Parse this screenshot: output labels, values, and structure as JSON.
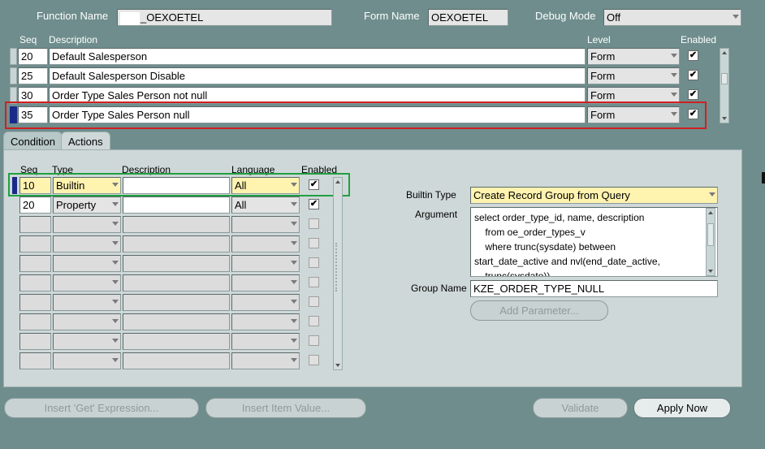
{
  "header": {
    "function_name_label": "Function Name",
    "function_name_value": "_OEXOETEL",
    "form_name_label": "Form Name",
    "form_name_value": "OEXOETEL",
    "debug_mode_label": "Debug Mode",
    "debug_mode_value": "Off"
  },
  "rules": {
    "col_seq": "Seq",
    "col_description": "Description",
    "col_level": "Level",
    "col_enabled": "Enabled",
    "rows": [
      {
        "seq": "20",
        "description": "Default Salesperson",
        "level": "Form",
        "enabled": "✔"
      },
      {
        "seq": "25",
        "description": "Default Salesperson Disable",
        "level": "Form",
        "enabled": "✔"
      },
      {
        "seq": "30",
        "description": "Order Type Sales Person not null",
        "level": "Form",
        "enabled": "✔"
      },
      {
        "seq": "35",
        "description": "Order Type Sales Person null",
        "level": "Form",
        "enabled": "✔"
      }
    ]
  },
  "tabs": {
    "condition": "Condition",
    "actions": "Actions"
  },
  "actions": {
    "col_seq": "Seq",
    "col_type": "Type",
    "col_description": "Description",
    "col_language": "Language",
    "col_enabled": "Enabled",
    "rows": [
      {
        "seq": "10",
        "type": "Builtin",
        "description": "",
        "language": "All",
        "enabled": "✔"
      },
      {
        "seq": "20",
        "type": "Property",
        "description": "",
        "language": "All",
        "enabled": "✔"
      }
    ]
  },
  "detail": {
    "builtin_type_label": "Builtin Type",
    "builtin_type_value": "Create Record Group from Query",
    "argument_label": "Argument",
    "argument_lines": [
      "select order_type_id, name, description",
      "    from oe_order_types_v",
      "    where trunc(sysdate) between",
      "start_date_active and nvl(end_date_active,",
      "    trunc(sysdate))"
    ],
    "group_name_label": "Group Name",
    "group_name_value": "KZE_ORDER_TYPE_NULL",
    "add_parameter_label": "Add Parameter..."
  },
  "buttons": {
    "insert_get_expression": "Insert 'Get' Expression...",
    "insert_item_value": "Insert Item Value...",
    "validate": "Validate",
    "apply_now": "Apply Now"
  },
  "colors": {
    "background": "#6f8d8d",
    "panel": "#cfd8d8",
    "highlight_red": "#d02020",
    "highlight_green": "#20a040",
    "current_yellow": "#fff3b0"
  }
}
